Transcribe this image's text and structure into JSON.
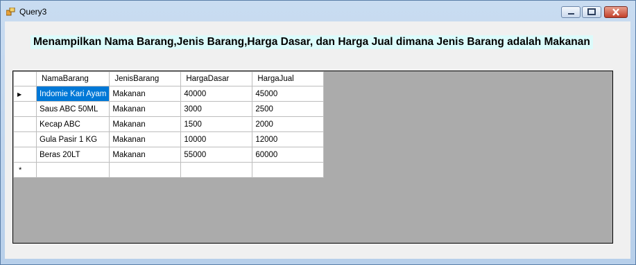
{
  "window": {
    "title": "Query3"
  },
  "heading": "Menampilkan Nama Barang,Jenis Barang,Harga Dasar, dan Harga Jual dimana Jenis Barang adalah Makanan",
  "grid": {
    "columns": [
      "NamaBarang",
      "JenisBarang",
      "HargaDasar",
      "HargaJual"
    ],
    "rows": [
      [
        "Indomie Kari Ayam",
        "Makanan",
        "40000",
        "45000"
      ],
      [
        "Saus ABC 50ML",
        "Makanan",
        "3000",
        "2500"
      ],
      [
        "Kecap ABC",
        "Makanan",
        "1500",
        "2000"
      ],
      [
        "Gula Pasir 1 KG",
        "Makanan",
        "10000",
        "12000"
      ],
      [
        "Beras 20LT",
        "Makanan",
        "55000",
        "60000"
      ]
    ],
    "current_row_glyph": "▶",
    "new_row_glyph": "*"
  }
}
